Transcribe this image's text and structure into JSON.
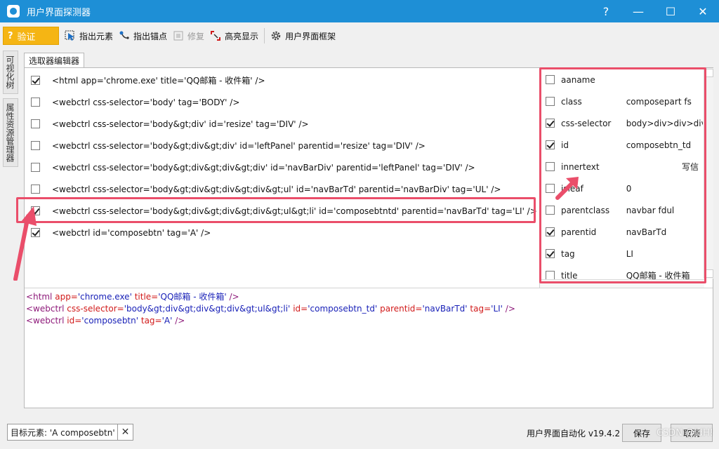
{
  "window": {
    "title": "用户界面探测器",
    "help": "?",
    "minimize": "—",
    "maximize": "☐",
    "close": "✕"
  },
  "toolbar": {
    "verify": "验证",
    "pick_element": "指出元素",
    "pick_anchor": "指出锚点",
    "repair": "修复",
    "highlight": "高亮显示",
    "ui_frame": "用户界面框架"
  },
  "side_tabs": [
    "可视化树",
    "属性资源管理器"
  ],
  "editor_tab": "选取器编辑器",
  "selector_rows": [
    {
      "checked": true,
      "text": "<html app='chrome.exe' title='QQ邮箱 - 收件箱' />"
    },
    {
      "checked": false,
      "text": "<webctrl css-selector='body' tag='BODY' />"
    },
    {
      "checked": false,
      "text": "<webctrl css-selector='body&gt;div' id='resize' tag='DIV' />"
    },
    {
      "checked": false,
      "text": "<webctrl css-selector='body&gt;div&gt;div' id='leftPanel' parentid='resize' tag='DIV' />"
    },
    {
      "checked": false,
      "text": "<webctrl css-selector='body&gt;div&gt;div&gt;div' id='navBarDiv' parentid='leftPanel' tag='DIV' />"
    },
    {
      "checked": false,
      "text": "<webctrl css-selector='body&gt;div&gt;div&gt;div&gt;ul' id='navBarTd' parentid='navBarDiv' tag='UL' />"
    },
    {
      "checked": true,
      "text": "<webctrl css-selector='body&gt;div&gt;div&gt;div&gt;ul&gt;li' id='composebtntd' parentid='navBarTd' tag='LI' />"
    },
    {
      "checked": true,
      "text": "<webctrl id='composebtn' tag='A' />"
    }
  ],
  "attributes": [
    {
      "checked": false,
      "name": "aaname",
      "value": "",
      "align": "left"
    },
    {
      "checked": false,
      "name": "class",
      "value": "composepart fs",
      "align": "left"
    },
    {
      "checked": true,
      "name": "css-selector",
      "value": "body>div>div>div",
      "align": "left"
    },
    {
      "checked": true,
      "name": "id",
      "value": "composebtn_td",
      "align": "left"
    },
    {
      "checked": false,
      "name": "innertext",
      "value": "写信",
      "align": "right"
    },
    {
      "checked": false,
      "name": "isleaf",
      "value": "0",
      "align": "left"
    },
    {
      "checked": false,
      "name": "parentclass",
      "value": "navbar fdul",
      "align": "left"
    },
    {
      "checked": true,
      "name": "parentid",
      "value": "navBarTd",
      "align": "left"
    },
    {
      "checked": true,
      "name": "tag",
      "value": "LI",
      "align": "left"
    },
    {
      "checked": false,
      "name": "title",
      "value": "QQ邮箱 - 收件箱",
      "align": "left"
    }
  ],
  "xml_preview": {
    "line1": {
      "tag": "<html",
      "a1": "app=",
      "v1": "'chrome.exe'",
      "a2": "title=",
      "v2": "'QQ邮箱 - 收件箱'",
      "end": "/>"
    },
    "line2": {
      "tag": "<webctrl",
      "a1": "css-selector=",
      "v1": "'body&gt;div&gt;div&gt;div&gt;ul&gt;li'",
      "a2": "id=",
      "v2": "'composebtn_td'",
      "a3": "parentid=",
      "v3": "'navBarTd'",
      "a4": "tag=",
      "v4": "'LI'",
      "end": "/>"
    },
    "line3": {
      "tag": "<webctrl",
      "a1": "id=",
      "v1": "'composebtn'",
      "a2": "tag=",
      "v2": "'A'",
      "end": "/>"
    }
  },
  "status": {
    "target_label": "目标元素: 'A  composebtn'",
    "target_close": "✕",
    "version": "用户界面自动化 v19.4.2",
    "save": "保存",
    "cancel": "取消",
    "watermark": "CSDN @ldH!"
  },
  "colors": {
    "titlebar": "#1e8fd6",
    "verify_button": "#f5b514",
    "highlight": "#ea4e6a",
    "xml_tag": "#8e1a7a",
    "xml_attr": "#d11a1a",
    "xml_value": "#1a22b8"
  }
}
